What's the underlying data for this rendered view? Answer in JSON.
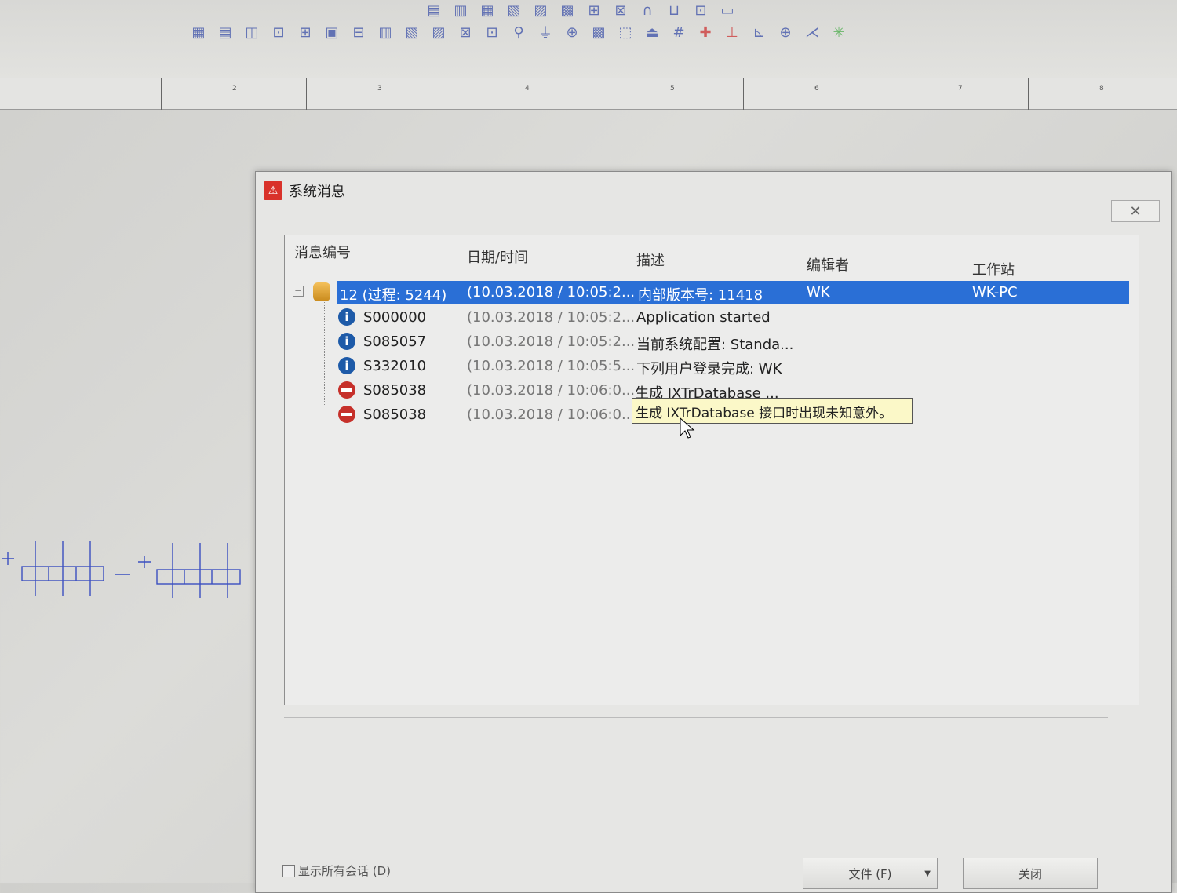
{
  "dialog": {
    "title": "系统消息",
    "close_icon": "✕"
  },
  "ruler": {
    "ticks": [
      "2",
      "3",
      "4",
      "5",
      "6",
      "7",
      "8"
    ]
  },
  "columns": [
    "消息编号",
    "日期/时间",
    "描述",
    "编辑者",
    "工作站"
  ],
  "rows": [
    {
      "id": "12 (过程: 5244)",
      "datetime": "(10.03.2018 / 10:05:2...",
      "desc": "内部版本号: 11418",
      "editor": "WK",
      "station": "WK-PC",
      "icon": "database-icon",
      "selected": true
    },
    {
      "id": "S000000",
      "datetime": "(10.03.2018 / 10:05:2...",
      "desc": "Application started",
      "icon": "info-icon"
    },
    {
      "id": "S085057",
      "datetime": "(10.03.2018 / 10:05:2...",
      "desc": "当前系统配置: Standa...",
      "icon": "info-icon"
    },
    {
      "id": "S332010",
      "datetime": "(10.03.2018 / 10:05:5...",
      "desc": "下列用户登录完成: WK",
      "icon": "info-icon"
    },
    {
      "id": "S085038",
      "datetime": "(10.03.2018 / 10:06:0...",
      "desc": "生成 IXTrDatabase ...",
      "icon": "error-icon"
    },
    {
      "id": "S085038",
      "datetime": "(10.03.2018 / 10:06:0...",
      "desc": "",
      "icon": "error-icon"
    }
  ],
  "tooltip": "生成 IXTrDatabase 接口时出现未知意外。",
  "footer": {
    "show_all_label": "显示所有会话 (D)",
    "file_button": "文件 (F)",
    "close_button": "关闭"
  }
}
